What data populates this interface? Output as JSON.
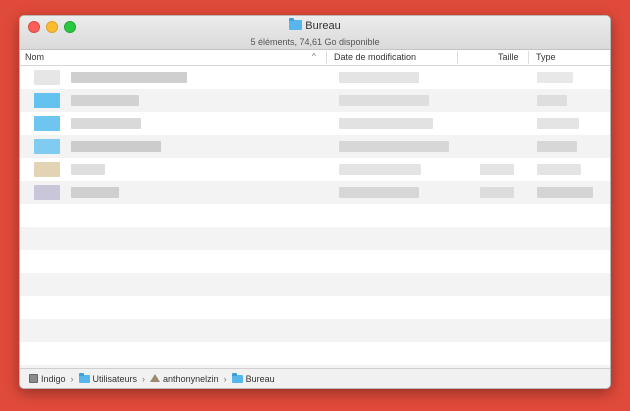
{
  "window": {
    "title": "Bureau",
    "status": "5 éléments, 74,61 Go disponible"
  },
  "columns": {
    "name": "Nom",
    "date": "Date de modification",
    "size": "Taille",
    "type": "Type"
  },
  "pathbar": {
    "items": [
      "Indigo",
      "Utilisateurs",
      "anthonynelzin",
      "Bureau"
    ],
    "separator": "›"
  },
  "colors": {
    "folder": "#59b6ec",
    "close": "#fc5f57",
    "minimize": "#fdbc2e",
    "maximize": "#28c840",
    "desktop_background": "#e04a3a"
  },
  "icons": {
    "window_title": "folder-icon",
    "sort_indicator": "chevron-up-icon",
    "path_volume": "hard-disk-icon",
    "path_users": "folder-icon",
    "path_home": "home-icon",
    "path_desktop": "folder-icon"
  }
}
